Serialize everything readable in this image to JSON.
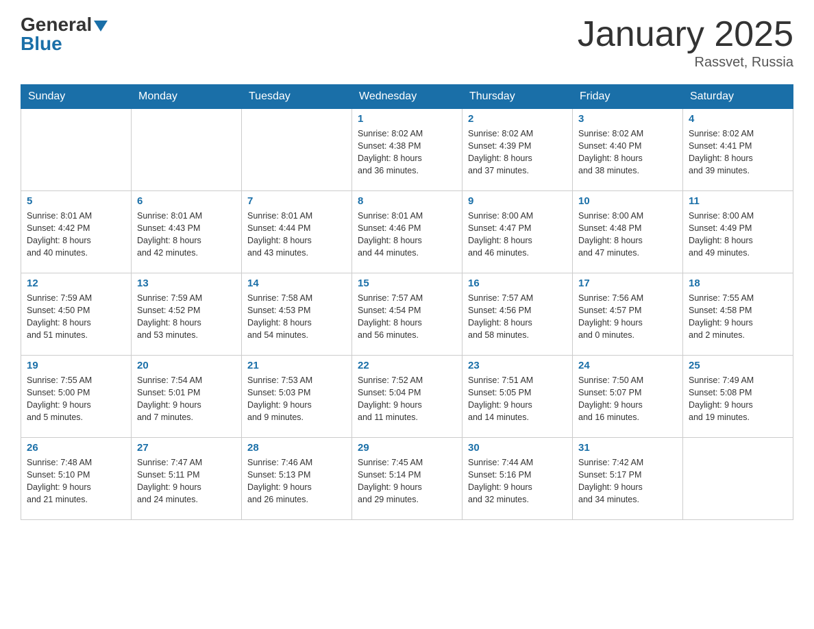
{
  "header": {
    "logo_general": "General",
    "logo_blue": "Blue",
    "title": "January 2025",
    "location": "Rassvet, Russia"
  },
  "days_of_week": [
    "Sunday",
    "Monday",
    "Tuesday",
    "Wednesday",
    "Thursday",
    "Friday",
    "Saturday"
  ],
  "weeks": [
    {
      "days": [
        {
          "number": "",
          "info": ""
        },
        {
          "number": "",
          "info": ""
        },
        {
          "number": "",
          "info": ""
        },
        {
          "number": "1",
          "info": "Sunrise: 8:02 AM\nSunset: 4:38 PM\nDaylight: 8 hours\nand 36 minutes."
        },
        {
          "number": "2",
          "info": "Sunrise: 8:02 AM\nSunset: 4:39 PM\nDaylight: 8 hours\nand 37 minutes."
        },
        {
          "number": "3",
          "info": "Sunrise: 8:02 AM\nSunset: 4:40 PM\nDaylight: 8 hours\nand 38 minutes."
        },
        {
          "number": "4",
          "info": "Sunrise: 8:02 AM\nSunset: 4:41 PM\nDaylight: 8 hours\nand 39 minutes."
        }
      ]
    },
    {
      "days": [
        {
          "number": "5",
          "info": "Sunrise: 8:01 AM\nSunset: 4:42 PM\nDaylight: 8 hours\nand 40 minutes."
        },
        {
          "number": "6",
          "info": "Sunrise: 8:01 AM\nSunset: 4:43 PM\nDaylight: 8 hours\nand 42 minutes."
        },
        {
          "number": "7",
          "info": "Sunrise: 8:01 AM\nSunset: 4:44 PM\nDaylight: 8 hours\nand 43 minutes."
        },
        {
          "number": "8",
          "info": "Sunrise: 8:01 AM\nSunset: 4:46 PM\nDaylight: 8 hours\nand 44 minutes."
        },
        {
          "number": "9",
          "info": "Sunrise: 8:00 AM\nSunset: 4:47 PM\nDaylight: 8 hours\nand 46 minutes."
        },
        {
          "number": "10",
          "info": "Sunrise: 8:00 AM\nSunset: 4:48 PM\nDaylight: 8 hours\nand 47 minutes."
        },
        {
          "number": "11",
          "info": "Sunrise: 8:00 AM\nSunset: 4:49 PM\nDaylight: 8 hours\nand 49 minutes."
        }
      ]
    },
    {
      "days": [
        {
          "number": "12",
          "info": "Sunrise: 7:59 AM\nSunset: 4:50 PM\nDaylight: 8 hours\nand 51 minutes."
        },
        {
          "number": "13",
          "info": "Sunrise: 7:59 AM\nSunset: 4:52 PM\nDaylight: 8 hours\nand 53 minutes."
        },
        {
          "number": "14",
          "info": "Sunrise: 7:58 AM\nSunset: 4:53 PM\nDaylight: 8 hours\nand 54 minutes."
        },
        {
          "number": "15",
          "info": "Sunrise: 7:57 AM\nSunset: 4:54 PM\nDaylight: 8 hours\nand 56 minutes."
        },
        {
          "number": "16",
          "info": "Sunrise: 7:57 AM\nSunset: 4:56 PM\nDaylight: 8 hours\nand 58 minutes."
        },
        {
          "number": "17",
          "info": "Sunrise: 7:56 AM\nSunset: 4:57 PM\nDaylight: 9 hours\nand 0 minutes."
        },
        {
          "number": "18",
          "info": "Sunrise: 7:55 AM\nSunset: 4:58 PM\nDaylight: 9 hours\nand 2 minutes."
        }
      ]
    },
    {
      "days": [
        {
          "number": "19",
          "info": "Sunrise: 7:55 AM\nSunset: 5:00 PM\nDaylight: 9 hours\nand 5 minutes."
        },
        {
          "number": "20",
          "info": "Sunrise: 7:54 AM\nSunset: 5:01 PM\nDaylight: 9 hours\nand 7 minutes."
        },
        {
          "number": "21",
          "info": "Sunrise: 7:53 AM\nSunset: 5:03 PM\nDaylight: 9 hours\nand 9 minutes."
        },
        {
          "number": "22",
          "info": "Sunrise: 7:52 AM\nSunset: 5:04 PM\nDaylight: 9 hours\nand 11 minutes."
        },
        {
          "number": "23",
          "info": "Sunrise: 7:51 AM\nSunset: 5:05 PM\nDaylight: 9 hours\nand 14 minutes."
        },
        {
          "number": "24",
          "info": "Sunrise: 7:50 AM\nSunset: 5:07 PM\nDaylight: 9 hours\nand 16 minutes."
        },
        {
          "number": "25",
          "info": "Sunrise: 7:49 AM\nSunset: 5:08 PM\nDaylight: 9 hours\nand 19 minutes."
        }
      ]
    },
    {
      "days": [
        {
          "number": "26",
          "info": "Sunrise: 7:48 AM\nSunset: 5:10 PM\nDaylight: 9 hours\nand 21 minutes."
        },
        {
          "number": "27",
          "info": "Sunrise: 7:47 AM\nSunset: 5:11 PM\nDaylight: 9 hours\nand 24 minutes."
        },
        {
          "number": "28",
          "info": "Sunrise: 7:46 AM\nSunset: 5:13 PM\nDaylight: 9 hours\nand 26 minutes."
        },
        {
          "number": "29",
          "info": "Sunrise: 7:45 AM\nSunset: 5:14 PM\nDaylight: 9 hours\nand 29 minutes."
        },
        {
          "number": "30",
          "info": "Sunrise: 7:44 AM\nSunset: 5:16 PM\nDaylight: 9 hours\nand 32 minutes."
        },
        {
          "number": "31",
          "info": "Sunrise: 7:42 AM\nSunset: 5:17 PM\nDaylight: 9 hours\nand 34 minutes."
        },
        {
          "number": "",
          "info": ""
        }
      ]
    }
  ]
}
